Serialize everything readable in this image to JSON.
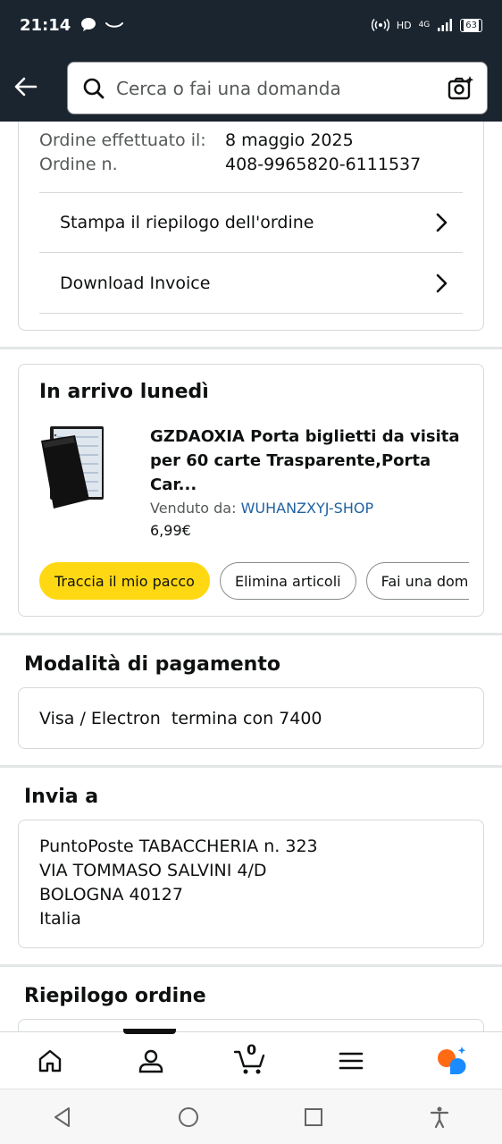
{
  "status_bar": {
    "time": "21:14",
    "hd": "HD",
    "network": "4G",
    "battery": "63"
  },
  "search": {
    "placeholder": "Cerca o fai una domanda"
  },
  "order": {
    "date_label": "Ordine effettuato il:",
    "date_value": "8 maggio 2025",
    "number_label": "Ordine n.",
    "number_value": "408-9965820-6111537",
    "print_summary": "Stampa il riepilogo dell'ordine",
    "download_invoice": "Download Invoice"
  },
  "delivery": {
    "heading": "In arrivo lunedì",
    "item_title_line1": "GZDAOXIA Porta biglietti da visita",
    "item_title_line2": "per 60 carte Trasparente,Porta Car...",
    "sold_by_label": "Venduto da:",
    "seller": "WUHANZXYJ-SHOP",
    "price": "6,99€",
    "buttons": [
      "Traccia il mio pacco",
      "Elimina articoli",
      "Fai una domanda"
    ]
  },
  "payment": {
    "title": "Modalità di pagamento",
    "method": "Visa / Electron  termina con 7400"
  },
  "shipping": {
    "title": "Invia a",
    "lines": [
      "PuntoPoste TABACCHERIA n. 323",
      "VIA TOMMASO SALVINI 4/D",
      "BOLOGNA 40127",
      "Italia"
    ]
  },
  "summary": {
    "title": "Riepilogo ordine"
  },
  "bottom_nav": {
    "cart_count": "0",
    "active": "account"
  },
  "colors": {
    "header_bg": "#1b2530",
    "primary_button": "#ffd814",
    "link": "#2162a1",
    "rufus_orange": "#ff6a13",
    "rufus_blue": "#1a8cff"
  }
}
